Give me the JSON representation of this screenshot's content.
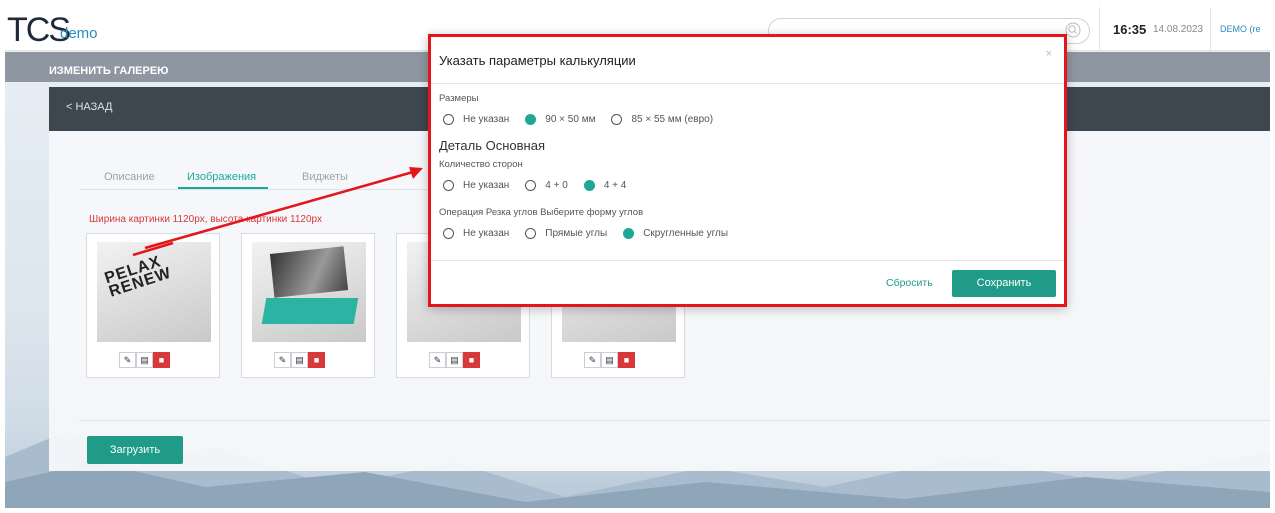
{
  "header": {
    "logo": "TCS",
    "logo_sub": "demo",
    "time": "16:35",
    "date": "14.08.2023",
    "user": "DEMO (re"
  },
  "page": {
    "title": "ИЗМЕНИТЬ ГАЛЕРЕЮ",
    "back": "< НАЗАД",
    "tabs": [
      "Описание",
      "Изображения",
      "Виджеты"
    ],
    "active_tab": "Изображения",
    "hint": "Ширина картинки 1120px, высота картинки 1120px",
    "upload_label": "Загрузить",
    "card_thumb_text": "PELAX RENEW"
  },
  "modal": {
    "title": "Указать параметры калькуляции",
    "close": "×",
    "groups": [
      {
        "label": "Размеры",
        "options": [
          {
            "label": "Не указан",
            "checked": false
          },
          {
            "label": "90 × 50 мм",
            "checked": true
          },
          {
            "label": "85 × 55 мм (евро)",
            "checked": false
          }
        ]
      },
      {
        "label": "Количество сторон",
        "options": [
          {
            "label": "Не указан",
            "checked": false
          },
          {
            "label": "4 + 0",
            "checked": false
          },
          {
            "label": "4 + 4",
            "checked": true
          }
        ]
      },
      {
        "label": "Операция Резка углов Выберите форму углов",
        "options": [
          {
            "label": "Не указан",
            "checked": false
          },
          {
            "label": "Прямые углы",
            "checked": false
          },
          {
            "label": "Скругленные углы",
            "checked": true
          }
        ]
      }
    ],
    "detail_title": "Деталь Основная",
    "reset_label": "Сбросить",
    "save_label": "Сохранить"
  },
  "colors": {
    "accent": "#1f9b88",
    "annotation": "#e3161c",
    "danger": "#d9383a"
  }
}
